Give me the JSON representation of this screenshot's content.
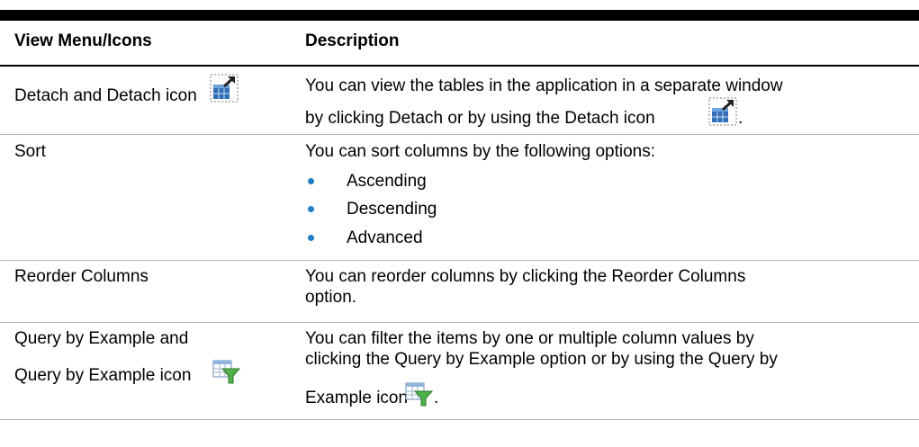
{
  "table": {
    "headers": [
      "View Menu/Icons",
      "Description"
    ],
    "rows": [
      {
        "menu": "Detach and Detach icon",
        "desc_lines": [
          "You can view the tables in the application in a separate window",
          "by clicking Detach or by using the Detach icon"
        ],
        "desc_end": "."
      },
      {
        "menu": "Sort",
        "desc_lines": [
          "You can sort columns by the following options:"
        ],
        "bullets": [
          "Ascending",
          "Descending",
          "Advanced"
        ]
      },
      {
        "menu": "Reorder Columns",
        "desc_lines": [
          "You can reorder columns by clicking the Reorder Columns",
          "option."
        ]
      },
      {
        "menu_lines": [
          "Query by Example and",
          "Query by Example icon"
        ],
        "desc_lines": [
          "You can filter the items by one or multiple column values by",
          "clicking the Query by Example option or by using the Query by",
          "Example icon"
        ],
        "desc_end": "."
      }
    ]
  },
  "icons": {
    "detach": "detach-icon",
    "query_by_example": "query-by-example-icon"
  },
  "colors": {
    "bullet": "#1f7fc9",
    "rule": "#b5b5b5",
    "header_bar": "#000000"
  }
}
